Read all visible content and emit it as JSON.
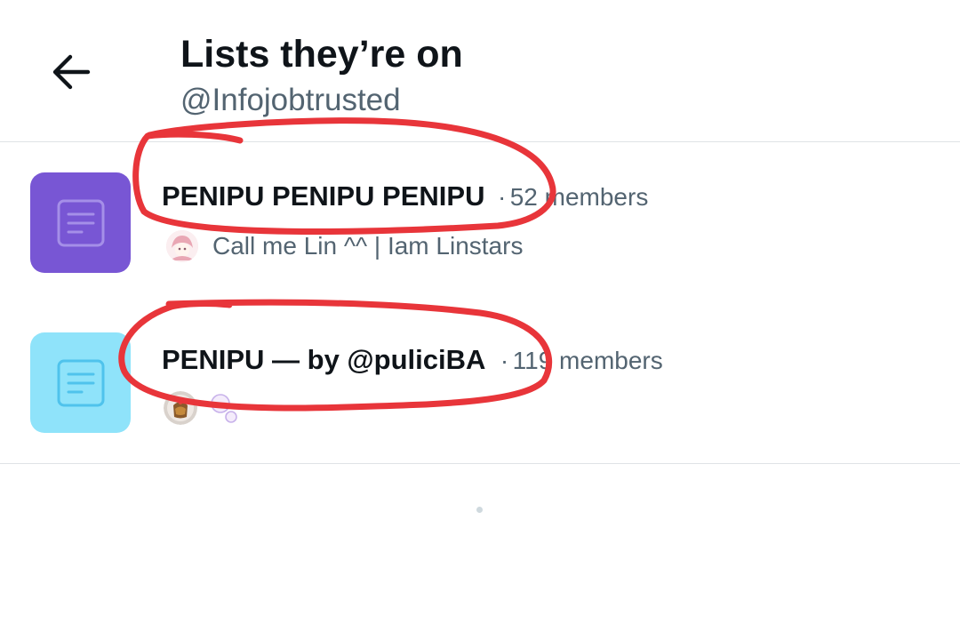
{
  "header": {
    "title": "Lists they’re on",
    "handle": "@Infojobtrusted"
  },
  "lists": [
    {
      "name": "PENIPU PENIPU PENIPU",
      "separator": "·",
      "members": "52 members",
      "owner": "Call me Lin ^^ | Iam Linstars",
      "thumb_color": "#7856d4"
    },
    {
      "name": "PENIPU — by @puliciBA",
      "separator": "·",
      "members": "119 members",
      "owner": "",
      "thumb_color": "#8fe3fa"
    }
  ],
  "icons": {
    "back": "arrow-left-icon",
    "list": "list-document-icon"
  },
  "colors": {
    "annotation": "#e8353a",
    "text_primary": "#0f1419",
    "text_secondary": "#536471"
  }
}
